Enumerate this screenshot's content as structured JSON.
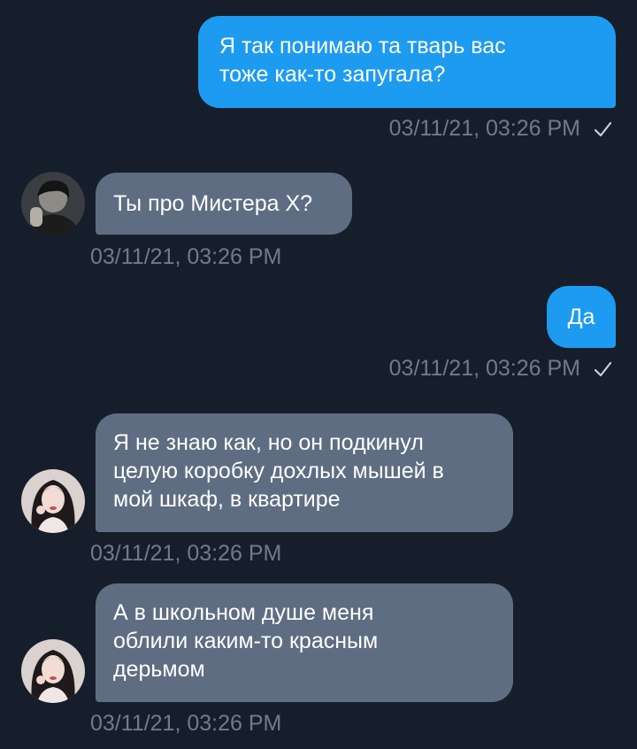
{
  "messages": [
    {
      "direction": "outgoing",
      "text": "Я так понимаю та тварь вас\nтоже как-то запугала?",
      "time": "03/11/21, 03:26 PM",
      "read_icon": "checkmark-icon"
    },
    {
      "direction": "incoming",
      "text": "Ты про Мистера Х?",
      "time": "03/11/21, 03:26 PM",
      "avatar": "avatar-dark-haired-man"
    },
    {
      "direction": "outgoing",
      "text": "Да",
      "time": "03/11/21, 03:26 PM",
      "read_icon": "checkmark-icon"
    },
    {
      "direction": "incoming",
      "text": "Я не знаю как, но он подкинул\nцелую коробку дохлых мышей в\nмой шкаф, в квартире",
      "time": "03/11/21, 03:26 PM",
      "avatar": "avatar-girl"
    },
    {
      "direction": "incoming",
      "text": "А в школьном душе меня\nоблили каким-то красным\nдерьмом",
      "time": "03/11/21, 03:26 PM",
      "avatar": "avatar-girl"
    }
  ],
  "colors": {
    "background": "#171e2b",
    "outgoing_bubble": "#1d9bf0",
    "incoming_bubble": "#5f6d82",
    "timestamp": "#6e7b8d"
  }
}
